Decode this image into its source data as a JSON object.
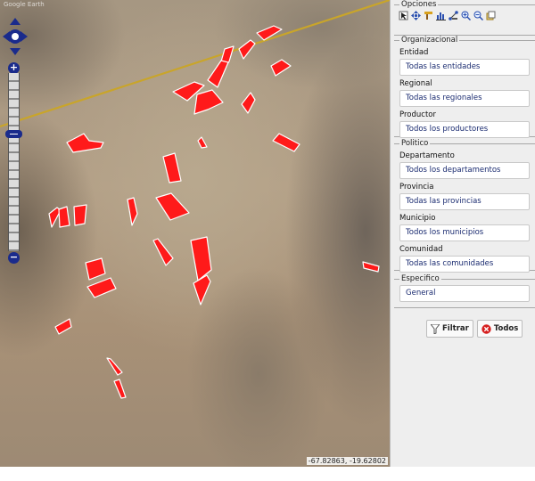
{
  "map": {
    "coordinates": "-67.82863, -19.62802",
    "attribution": "Google Earth",
    "zoom_in_label": "+",
    "zoom_out_label": "−"
  },
  "panel": {
    "options": {
      "legend": "Opciones",
      "tools": [
        "select-icon",
        "pan-icon",
        "measure-icon",
        "chart-icon",
        "node-icon",
        "zoom-in-icon",
        "zoom-out-icon",
        "export-icon"
      ]
    },
    "organizacional": {
      "legend": "Organizacional",
      "entidad_label": "Entidad",
      "entidad_value": "Todas las entidades",
      "regional_label": "Regional",
      "regional_value": "Todas las regionales",
      "productor_label": "Productor",
      "productor_value": "Todos los productores"
    },
    "politico": {
      "legend": "Politico",
      "departamento_label": "Departamento",
      "departamento_value": "Todos los departamentos",
      "provincia_label": "Provincia",
      "provincia_value": "Todas las provincias",
      "municipio_label": "Municipio",
      "municipio_value": "Todos los municipios",
      "comunidad_label": "Comunidad",
      "comunidad_value": "Todas las comunidades"
    },
    "especifico": {
      "legend": "Especifico",
      "value": "General"
    },
    "actions": {
      "filtrar_label": "Filtrar",
      "todos_label": "Todos"
    }
  },
  "colors": {
    "parcel_fill": "#ff1a1a",
    "road": "#c9a52a",
    "control_blue": "#1a2b8c",
    "panel_bg": "#eeeeee"
  }
}
